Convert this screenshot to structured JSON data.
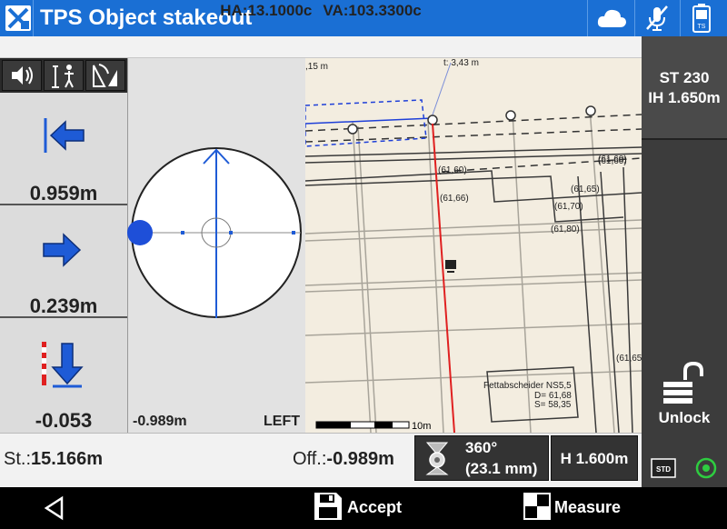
{
  "title_bar": {
    "app_title": "TPS Object stakeout"
  },
  "angles": {
    "ha": "HA:13.1000c",
    "va": "VA:103.3300c"
  },
  "navigation": {
    "move_left_value": "0.959m",
    "move_right_value": "0.239m",
    "move_down_value": "-0.053"
  },
  "compass": {
    "offset": "-0.989m",
    "side": "LEFT"
  },
  "map": {
    "scale_label": "10m",
    "labels": [
      "(61,60)",
      "(61,66)",
      "(61,60)",
      "(61,65)",
      "(61,70)",
      "(61,80)",
      "(61,65)",
      "Fettabscheider NS5,5",
      "D= 61,68",
      "S= 58,35",
      "t: 3,43 m",
      ",15 m"
    ]
  },
  "right_panel": {
    "station": "ST 230",
    "instrument_height": "IH 1.650m",
    "unlock_label": "Unlock",
    "std_label": "STD"
  },
  "status": {
    "station_prefix": "St.:",
    "station_value": "15.166m",
    "offset_prefix": "Off.:",
    "offset_value": "-0.989m",
    "prism_angle": "360°",
    "prism_constant": "(23.1 mm)",
    "target_height": "H 1.600m"
  },
  "bottom_nav": {
    "accept_label": "Accept",
    "measure_label": "Measure"
  },
  "colors": {
    "accent": "#1a6fd4",
    "stakeout_line": "#e02020",
    "arrow_blue": "#1e5bd6",
    "map_bg": "#f3ede0"
  }
}
